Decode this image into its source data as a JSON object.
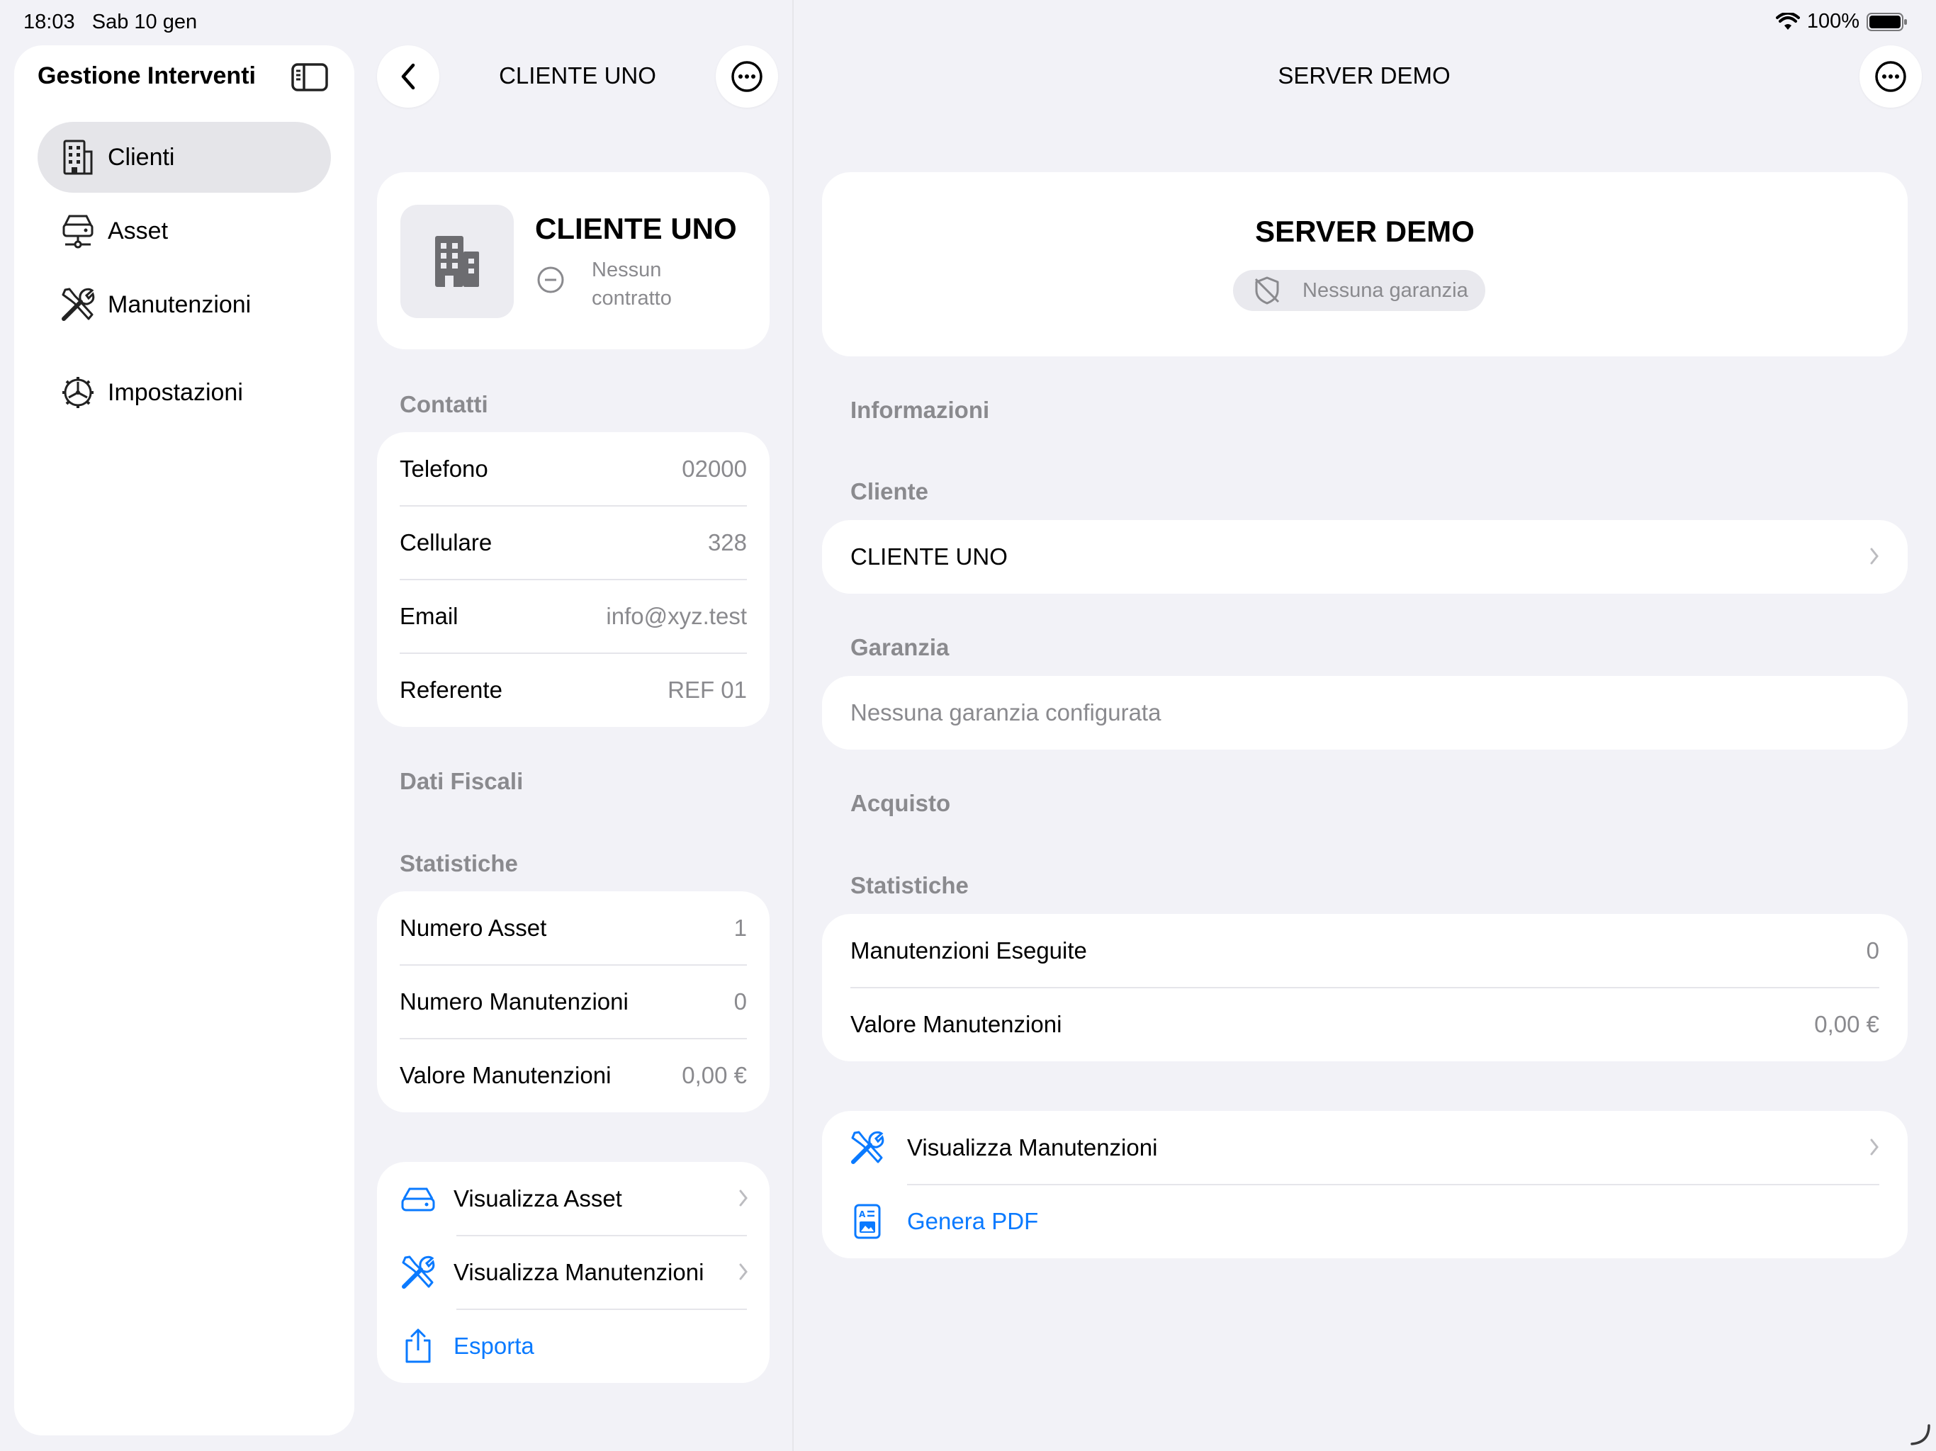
{
  "status": {
    "time": "18:03",
    "date": "Sab 10 gen",
    "battery": "100%"
  },
  "sidebar": {
    "title": "Gestione Interventi",
    "items": [
      {
        "label": "Clienti",
        "icon": "building-icon",
        "active": true
      },
      {
        "label": "Asset",
        "icon": "server-icon",
        "active": false
      },
      {
        "label": "Manutenzioni",
        "icon": "wrench-screwdriver-icon",
        "active": false
      },
      {
        "label": "Impostazioni",
        "icon": "gear-icon",
        "active": false
      }
    ]
  },
  "middle": {
    "nav_title": "CLIENTE UNO",
    "header": {
      "name": "CLIENTE UNO",
      "contract_status": "Nessun contratto"
    },
    "contacts": {
      "heading": "Contatti",
      "rows": [
        {
          "label": "Telefono",
          "value": "02000"
        },
        {
          "label": "Cellulare",
          "value": "328"
        },
        {
          "label": "Email",
          "value": "info@xyz.test"
        },
        {
          "label": "Referente",
          "value": "REF 01"
        }
      ]
    },
    "fiscal_heading": "Dati Fiscali",
    "stats": {
      "heading": "Statistiche",
      "rows": [
        {
          "label": "Numero Asset",
          "value": "1"
        },
        {
          "label": "Numero Manutenzioni",
          "value": "0"
        },
        {
          "label": "Valore Manutenzioni",
          "value": "0,00 €"
        }
      ]
    },
    "actions": [
      {
        "label": "Visualizza Asset",
        "icon": "drive-icon"
      },
      {
        "label": "Visualizza Manutenzioni",
        "icon": "wrench-screwdriver-icon"
      },
      {
        "label": "Esporta",
        "icon": "share-icon"
      }
    ]
  },
  "detail": {
    "nav_title": "SERVER DEMO",
    "header": {
      "name": "SERVER DEMO",
      "warranty_badge": "Nessuna garanzia"
    },
    "info_heading": "Informazioni",
    "cliente": {
      "heading": "Cliente",
      "value": "CLIENTE UNO"
    },
    "garanzia": {
      "heading": "Garanzia",
      "value": "Nessuna garanzia configurata"
    },
    "acquisto_heading": "Acquisto",
    "stats": {
      "heading": "Statistiche",
      "rows": [
        {
          "label": "Manutenzioni Eseguite",
          "value": "0"
        },
        {
          "label": "Valore Manutenzioni",
          "value": "0,00 €"
        }
      ]
    },
    "actions": [
      {
        "label": "Visualizza Manutenzioni",
        "icon": "wrench-screwdriver-icon"
      },
      {
        "label": "Genera PDF",
        "icon": "pdf-document-icon"
      }
    ]
  },
  "colors": {
    "accent": "#0a7aff",
    "background": "#f2f2f7",
    "secondary_text": "#8a8a8e"
  }
}
